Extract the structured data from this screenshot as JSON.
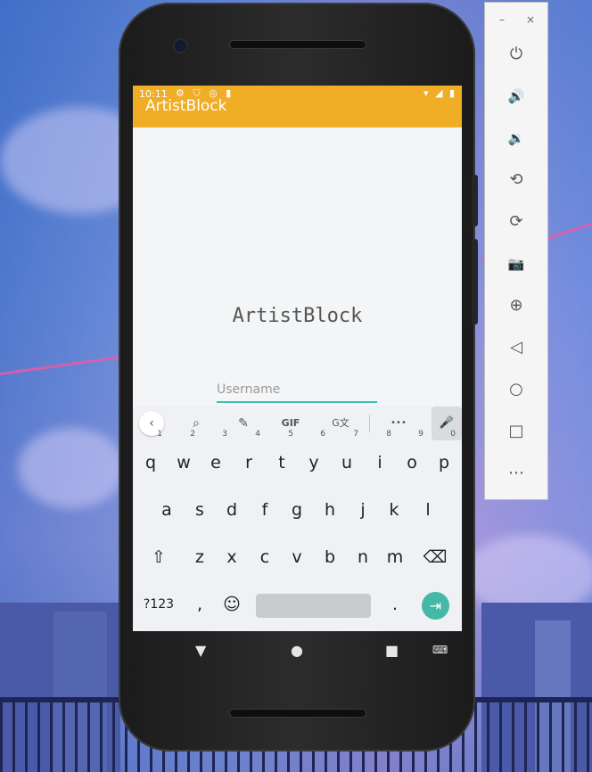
{
  "emulator_panel": {
    "minimize_label": "–",
    "close_label": "×",
    "buttons": [
      {
        "name": "power-icon",
        "glyph": "⏻"
      },
      {
        "name": "volume-up-icon",
        "glyph": "🔊"
      },
      {
        "name": "volume-down-icon",
        "glyph": "🔉"
      },
      {
        "name": "rotate-left-icon",
        "glyph": "⟲"
      },
      {
        "name": "rotate-right-icon",
        "glyph": "⟳"
      },
      {
        "name": "camera-icon",
        "glyph": "📷"
      },
      {
        "name": "zoom-icon",
        "glyph": "⊕"
      },
      {
        "name": "back-icon",
        "glyph": "◁"
      },
      {
        "name": "home-icon",
        "glyph": "○"
      },
      {
        "name": "overview-icon",
        "glyph": "□"
      },
      {
        "name": "more-icon",
        "glyph": "⋯"
      }
    ]
  },
  "status_bar": {
    "time": "10:11",
    "left_icons": "⚙ ⛉ ◎ ▮",
    "right_icons": "▾ ◢ ▮"
  },
  "app_bar": {
    "title": "ArtistBlock"
  },
  "main": {
    "title": "ArtistBlock",
    "username_placeholder": "Username",
    "username_value": ""
  },
  "keyboard": {
    "toolbar": {
      "back": "‹",
      "search": "⌕",
      "sticker": "✎",
      "gif": "GIF",
      "translate": "G文",
      "more": "•••",
      "mic": "🎤"
    },
    "row1": [
      {
        "k": "q",
        "h": "1"
      },
      {
        "k": "w",
        "h": "2"
      },
      {
        "k": "e",
        "h": "3"
      },
      {
        "k": "r",
        "h": "4"
      },
      {
        "k": "t",
        "h": "5"
      },
      {
        "k": "y",
        "h": "6"
      },
      {
        "k": "u",
        "h": "7"
      },
      {
        "k": "i",
        "h": "8"
      },
      {
        "k": "o",
        "h": "9"
      },
      {
        "k": "p",
        "h": "0"
      }
    ],
    "row2": [
      "a",
      "s",
      "d",
      "f",
      "g",
      "h",
      "j",
      "k",
      "l"
    ],
    "row3": [
      "z",
      "x",
      "c",
      "v",
      "b",
      "n",
      "m"
    ],
    "shift": "⇧",
    "backspace": "⌫",
    "symbols": "?123",
    "comma": ",",
    "emoji": "☺",
    "period": ".",
    "enter": "⇥"
  },
  "nav_bar": {
    "back": "▼",
    "home": "●",
    "recents": "■",
    "keyboard": "⌨"
  }
}
